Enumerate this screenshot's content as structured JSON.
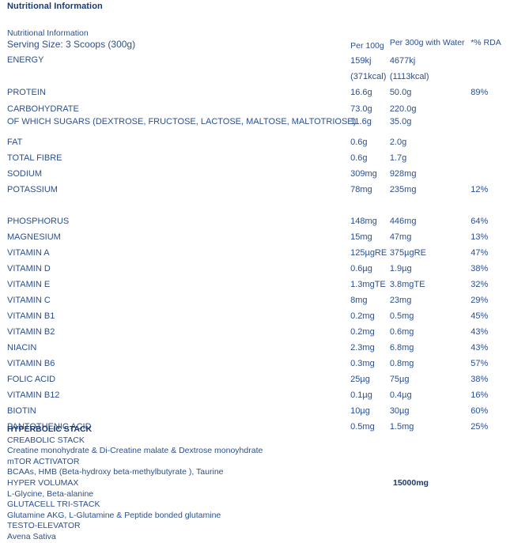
{
  "title": "Nutritional Information",
  "table": {
    "header": {
      "sub_title": "Nutritional Information",
      "serving_size": "Serving Size: 3 Scoops (300g)",
      "col_per_100g": "Per 100g",
      "col_per_300g": "Per 300g with Water",
      "col_rda": "*% RDA"
    },
    "rows": [
      {
        "name": "ENERGY",
        "per_100g": "159kj",
        "per_100g_2": "(371kcal)",
        "per_300g": "4677kj",
        "per_300g_2": "(1113kcal)",
        "rda": ""
      },
      {
        "name": "PROTEIN",
        "per_100g": "16.6g",
        "per_300g": "50.0g",
        "rda": "89%"
      },
      {
        "name": "CARBOHYDRATE",
        "per_100g": "73.0g",
        "per_300g": "220.0g",
        "rda": ""
      },
      {
        "name": "OF WHICH SUGARS (DEXTROSE, FRUCTOSE, LACTOSE, MALTOSE, MALTOTRIOSE)",
        "per_100g": "11.6g",
        "per_300g": "35.0g",
        "rda": ""
      },
      {
        "name": "FAT",
        "per_100g": "0.6g",
        "per_300g": "2.0g",
        "rda": ""
      },
      {
        "name": "TOTAL FIBRE",
        "per_100g": "0.6g",
        "per_300g": "1.7g",
        "rda": ""
      },
      {
        "name": "SODIUM",
        "per_100g": "309mg",
        "per_300g": "928mg",
        "rda": ""
      },
      {
        "name": "POTASSIUM",
        "per_100g": "78mg",
        "per_300g": "235mg",
        "rda": "12%"
      },
      {
        "name": "PHOSPHORUS",
        "per_100g": "148mg",
        "per_300g": "446mg",
        "rda": "64%"
      },
      {
        "name": "MAGNESIUM",
        "per_100g": "15mg",
        "per_300g": "47mg",
        "rda": "13%"
      },
      {
        "name": "VITAMIN A",
        "per_100g": "125µgRE",
        "per_300g": "375µgRE",
        "rda": "47%"
      },
      {
        "name": "VITAMIN D",
        "per_100g": "0.6µg",
        "per_300g": "1.9µg",
        "rda": "38%"
      },
      {
        "name": "VITAMIN E",
        "per_100g": "1.3mgTE",
        "per_300g": "3.8mgTE",
        "rda": "32%"
      },
      {
        "name": "VITAMIN C",
        "per_100g": "8mg",
        "per_300g": "23mg",
        "rda": "29%"
      },
      {
        "name": "VITAMIN B1",
        "per_100g": "0.2mg",
        "per_300g": "0.5mg",
        "rda": "45%"
      },
      {
        "name": "VITAMIN B2",
        "per_100g": "0.2mg",
        "per_300g": "0.6mg",
        "rda": "43%"
      },
      {
        "name": "NIACIN",
        "per_100g": "2.3mg",
        "per_300g": "6.8mg",
        "rda": "43%"
      },
      {
        "name": "VITAMIN B6",
        "per_100g": "0.3mg",
        "per_300g": "0.8mg",
        "rda": "57%"
      },
      {
        "name": "FOLIC ACID",
        "per_100g": "25µg",
        "per_300g": "75µg",
        "rda": "38%"
      },
      {
        "name": "VITAMIN B12",
        "per_100g": "0.1µg",
        "per_300g": "0.4µg",
        "rda": "16%"
      },
      {
        "name": "BIOTIN",
        "per_100g": "10µg",
        "per_300g": "30µg",
        "rda": "60%"
      },
      {
        "name": "PANTOTHENIC ACID",
        "per_100g": "0.5mg",
        "per_300g": "1.5mg",
        "rda": "25%"
      }
    ]
  },
  "stack": [
    {
      "text": "HYPERBOLIC STACK",
      "bold": true,
      "amount": ""
    },
    {
      "text": "CREABOLIC STACK",
      "bold": false,
      "amount": ""
    },
    {
      "text": "Creatine monohydrate & Di-Creatine malate & Dextrose monoyhdrate",
      "bold": false,
      "amount": ""
    },
    {
      "text": "mTOR ACTIVATOR",
      "bold": false,
      "amount": ""
    },
    {
      "text": "BCAAs, HMB (Beta-hydroxy beta-methylbutyrate ), Taurine",
      "bold": false,
      "amount": ""
    },
    {
      "text": "HYPER VOLUMAX",
      "bold": false,
      "amount": "15000mg"
    },
    {
      "text": "L-Glycine, Beta-alanine",
      "bold": false,
      "amount": ""
    },
    {
      "text": "GLUTACELL TRI-STACK",
      "bold": false,
      "amount": ""
    },
    {
      "text": "Glutamine AKG, L-Glutamine & Peptide bonded glutamine",
      "bold": false,
      "amount": ""
    },
    {
      "text": "TESTO-ELEVATOR",
      "bold": false,
      "amount": ""
    },
    {
      "text": "Avena Sativa",
      "bold": false,
      "amount": ""
    }
  ],
  "colors": {
    "heading": "#1b3a72",
    "body": "#2c4f8c",
    "background": "#ffffff"
  }
}
